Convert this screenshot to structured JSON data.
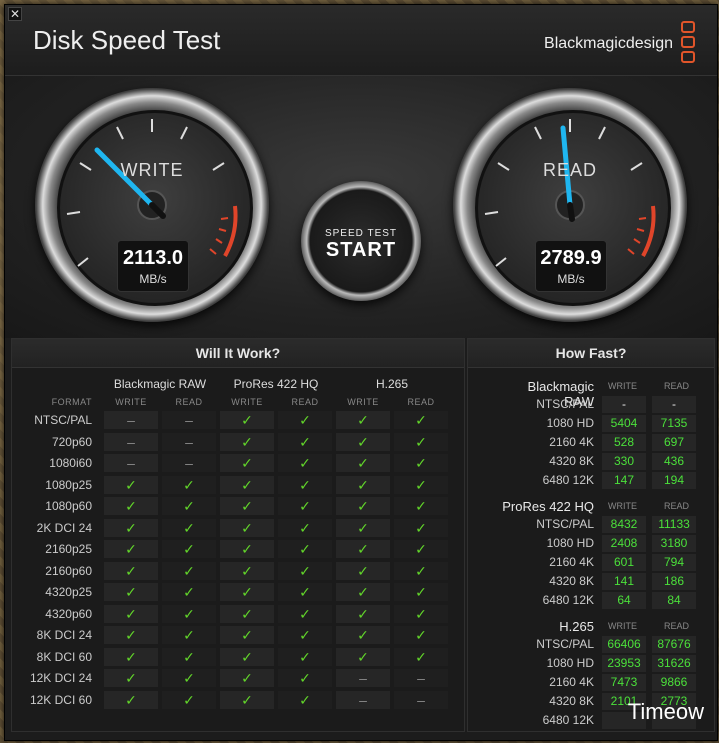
{
  "app": {
    "title": "Disk Speed Test",
    "brand": "Blackmagicdesign",
    "close_glyph": "✕"
  },
  "gauges": {
    "write": {
      "label": "WRITE",
      "value": "2113.0",
      "unit": "MB/s"
    },
    "read": {
      "label": "READ",
      "value": "2789.9",
      "unit": "MB/s"
    }
  },
  "controls": {
    "settings_icon": "gear-icon",
    "start_small": "SPEED TEST",
    "start_big": "START"
  },
  "will_it_work": {
    "title": "Will It Work?",
    "format_header": "FORMAT",
    "groups": [
      "Blackmagic RAW",
      "ProRes 422 HQ",
      "H.265"
    ],
    "sub_headers": [
      "WRITE",
      "READ"
    ],
    "rows": [
      {
        "format": "NTSC/PAL",
        "cells": [
          "–",
          "–",
          "✓",
          "✓",
          "✓",
          "✓"
        ]
      },
      {
        "format": "720p60",
        "cells": [
          "–",
          "–",
          "✓",
          "✓",
          "✓",
          "✓"
        ]
      },
      {
        "format": "1080i60",
        "cells": [
          "–",
          "–",
          "✓",
          "✓",
          "✓",
          "✓"
        ]
      },
      {
        "format": "1080p25",
        "cells": [
          "✓",
          "✓",
          "✓",
          "✓",
          "✓",
          "✓"
        ]
      },
      {
        "format": "1080p60",
        "cells": [
          "✓",
          "✓",
          "✓",
          "✓",
          "✓",
          "✓"
        ]
      },
      {
        "format": "2K DCI 24",
        "cells": [
          "✓",
          "✓",
          "✓",
          "✓",
          "✓",
          "✓"
        ]
      },
      {
        "format": "2160p25",
        "cells": [
          "✓",
          "✓",
          "✓",
          "✓",
          "✓",
          "✓"
        ]
      },
      {
        "format": "2160p60",
        "cells": [
          "✓",
          "✓",
          "✓",
          "✓",
          "✓",
          "✓"
        ]
      },
      {
        "format": "4320p25",
        "cells": [
          "✓",
          "✓",
          "✓",
          "✓",
          "✓",
          "✓"
        ]
      },
      {
        "format": "4320p60",
        "cells": [
          "✓",
          "✓",
          "✓",
          "✓",
          "✓",
          "✓"
        ]
      },
      {
        "format": "8K DCI 24",
        "cells": [
          "✓",
          "✓",
          "✓",
          "✓",
          "✓",
          "✓"
        ]
      },
      {
        "format": "8K DCI 60",
        "cells": [
          "✓",
          "✓",
          "✓",
          "✓",
          "✓",
          "✓"
        ]
      },
      {
        "format": "12K DCI 24",
        "cells": [
          "✓",
          "✓",
          "✓",
          "✓",
          "–",
          "–"
        ]
      },
      {
        "format": "12K DCI 60",
        "cells": [
          "✓",
          "✓",
          "✓",
          "✓",
          "–",
          "–"
        ]
      }
    ]
  },
  "how_fast": {
    "title": "How Fast?",
    "groups": [
      {
        "name": "Blackmagic RAW",
        "rows": [
          {
            "label": "NTSC/PAL",
            "write": "-",
            "read": "-"
          },
          {
            "label": "1080 HD",
            "write": "5404",
            "read": "7135"
          },
          {
            "label": "2160 4K",
            "write": "528",
            "read": "697"
          },
          {
            "label": "4320 8K",
            "write": "330",
            "read": "436"
          },
          {
            "label": "6480 12K",
            "write": "147",
            "read": "194"
          }
        ]
      },
      {
        "name": "ProRes 422 HQ",
        "rows": [
          {
            "label": "NTSC/PAL",
            "write": "8432",
            "read": "11133"
          },
          {
            "label": "1080 HD",
            "write": "2408",
            "read": "3180"
          },
          {
            "label": "2160 4K",
            "write": "601",
            "read": "794"
          },
          {
            "label": "4320 8K",
            "write": "141",
            "read": "186"
          },
          {
            "label": "6480 12K",
            "write": "64",
            "read": "84"
          }
        ]
      },
      {
        "name": "H.265",
        "rows": [
          {
            "label": "NTSC/PAL",
            "write": "66406",
            "read": "87676"
          },
          {
            "label": "1080 HD",
            "write": "23953",
            "read": "31626"
          },
          {
            "label": "2160 4K",
            "write": "7473",
            "read": "9866"
          },
          {
            "label": "4320 8K",
            "write": "2101",
            "read": "2773"
          },
          {
            "label": "6480 12K",
            "write": "",
            "read": ""
          }
        ]
      }
    ],
    "sub_headers": [
      "WRITE",
      "READ"
    ]
  },
  "watermark": "Timeow",
  "colors": {
    "check": "#62d62a",
    "value": "#4be03a",
    "needle": "#1fb6f0",
    "redzone": "#e0452a",
    "brand": "#e0552a"
  }
}
